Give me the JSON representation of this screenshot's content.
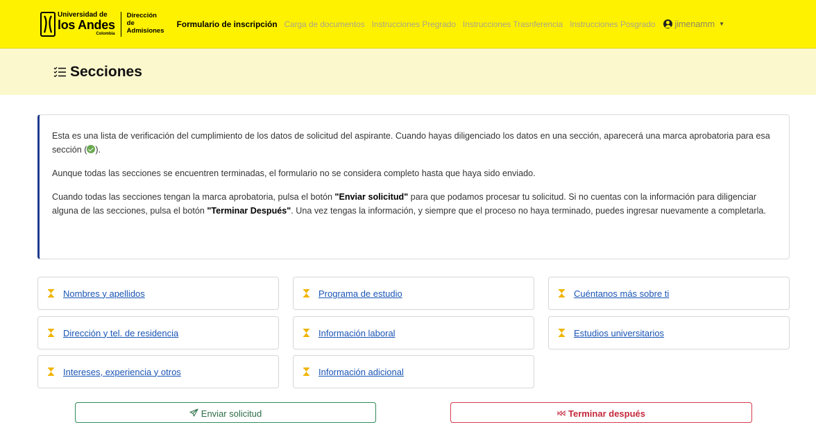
{
  "navbar": {
    "logo": {
      "line1": "Universidad de",
      "line2": "los Andes",
      "line3": "Colombia",
      "department": "Dirección de Admisiones"
    },
    "links": [
      {
        "label": "Formulario de inscripción",
        "active": true
      },
      {
        "label": "Carga de documentos",
        "active": false
      },
      {
        "label": "Instrucciones Pregrado",
        "active": false
      },
      {
        "label": "Instrucciones Trasnferencia",
        "active": false
      },
      {
        "label": "Instrucciones Posgrado",
        "active": false
      }
    ],
    "user": {
      "name": "jimenamm",
      "icon": "user-circle-icon"
    }
  },
  "header": {
    "title": "Secciones",
    "icon": "list-check-icon"
  },
  "info": {
    "p1_a": "Esta es una lista de verificación del cumplimiento de los datos de solicitud del aspirante. Cuando hayas diligenciado los datos en una sección, aparecerá una marca aprobatoria para esa sección (",
    "p1_b": ").",
    "p2": "Aunque todas las secciones se encuentren terminadas, el formulario no se considera completo hasta que haya sido enviado.",
    "p3_a": "Cuando todas las secciones tengan la marca aprobatoria, pulsa el botón ",
    "p3_b": "\"Enviar solicitud\"",
    "p3_c": " para que podamos procesar tu solicitud. Si no cuentas con la información para diligenciar alguna de las secciones, pulsa el botón ",
    "p3_d": "\"Terminar Después\"",
    "p3_e": ". Una vez tengas la información, y siempre que el proceso no haya terminado, puedes ingresar nuevamente a completarla."
  },
  "sections": [
    {
      "label": "Nombres y apellidos",
      "status": "pending"
    },
    {
      "label": "Programa de estudio",
      "status": "pending"
    },
    {
      "label": "Cuéntanos más sobre ti",
      "status": "pending"
    },
    {
      "label": "Dirección y tel. de residencia",
      "status": "pending"
    },
    {
      "label": "Información laboral",
      "status": "pending"
    },
    {
      "label": "Estudios universitarios",
      "status": "pending"
    },
    {
      "label": "Intereses, experiencia y otros",
      "status": "pending"
    },
    {
      "label": "Información adicional",
      "status": "pending"
    }
  ],
  "buttons": {
    "send": {
      "label": "Enviar solicitud",
      "icon": "paper-plane-icon"
    },
    "later": {
      "label": "Terminar después",
      "icon": "fast-backward-icon"
    }
  },
  "colors": {
    "navbar_bg": "#fff200",
    "header_bg": "#fcf8ce",
    "info_border_accent": "#1e3a8a",
    "link": "#1a55b5",
    "pending_icon": "#f0b400",
    "send_border": "#2e8b57",
    "later_border": "#d6394b"
  }
}
